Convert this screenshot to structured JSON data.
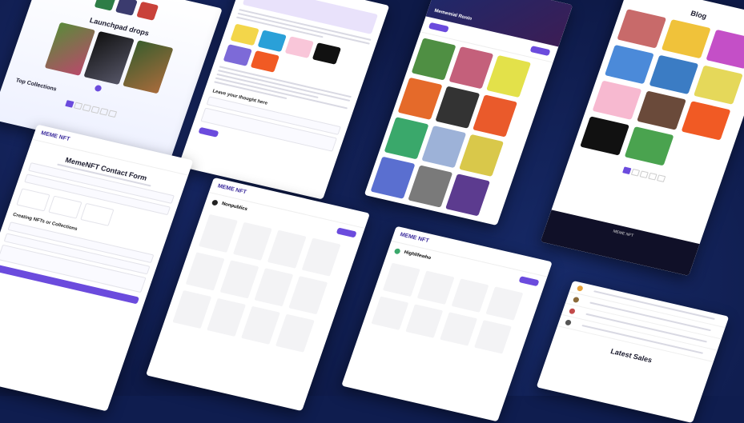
{
  "launchpad": {
    "title": "Launchpad drops",
    "section2": "Top Collections"
  },
  "contact": {
    "logo": "MEME NFT",
    "title": "MemeNFT Contact Form",
    "section": "Creating NFTs or Collections"
  },
  "collection": {
    "logo": "MEME NFT",
    "name": "Nonpublics"
  },
  "blog": {
    "title": "Blog",
    "logo": "MEME NFT"
  },
  "sales": {
    "title": "Latest Sales"
  },
  "profile": {
    "logo": "MEME NFT",
    "name": "Highlifewho"
  },
  "article": {
    "prompt": "Leave your thought here"
  },
  "hero": {
    "name": "Mememial Ronin"
  },
  "colors": {
    "accent": "#6b4bdd",
    "background": "#0e1a48"
  }
}
